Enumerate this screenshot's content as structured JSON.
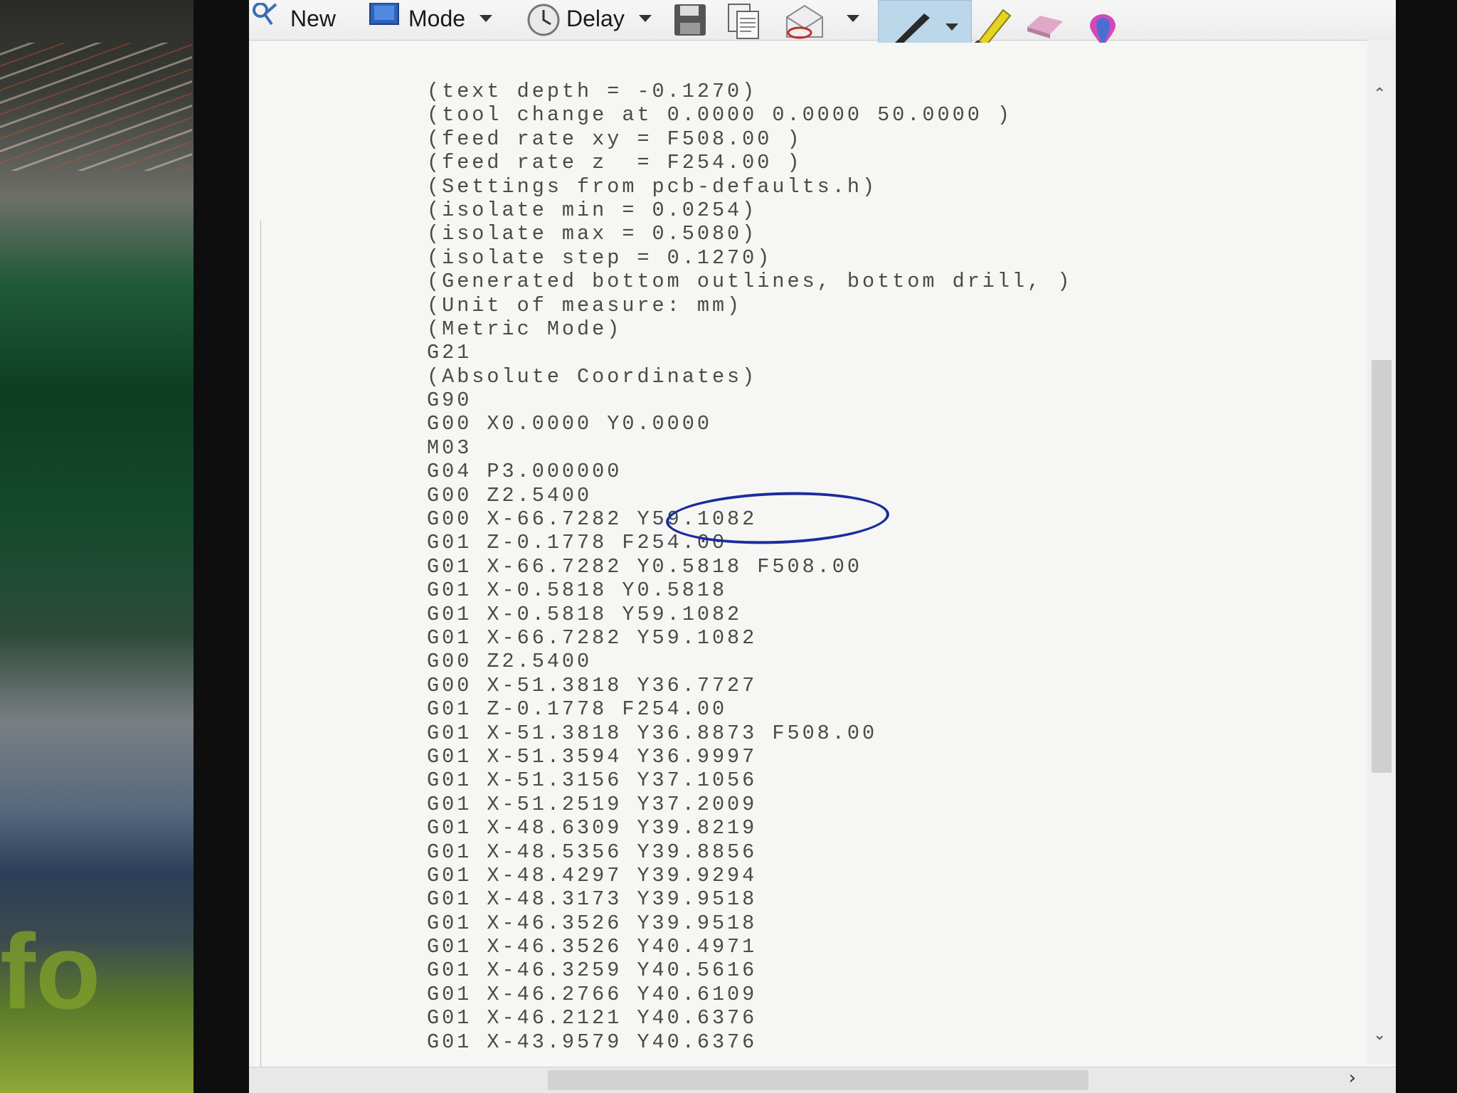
{
  "toolbar": {
    "new_label": "New",
    "mode_label": "Mode",
    "delay_label": "Delay"
  },
  "code_lines": [
    "(text depth = -0.1270)",
    "(tool change at 0.0000 0.0000 50.0000 )",
    "(feed rate xy = F508.00 )",
    "(feed rate z  = F254.00 )",
    "(Settings from pcb-defaults.h)",
    "(isolate min = 0.0254)",
    "(isolate max = 0.5080)",
    "(isolate step = 0.1270)",
    "(Generated bottom outlines, bottom drill, )",
    "(Unit of measure: mm)",
    "(Metric Mode)",
    "G21",
    "(Absolute Coordinates)",
    "G90",
    "G00 X0.0000 Y0.0000",
    "M03",
    "G04 P3.000000",
    "G00 Z2.5400",
    "G00 X-66.7282 Y59.1082",
    "G01 Z-0.1778 F254.00",
    "G01 X-66.7282 Y0.5818 F508.00",
    "G01 X-0.5818 Y0.5818",
    "G01 X-0.5818 Y59.1082",
    "G01 X-66.7282 Y59.1082",
    "G00 Z2.5400",
    "G00 X-51.3818 Y36.7727",
    "G01 Z-0.1778 F254.00",
    "G01 X-51.3818 Y36.8873 F508.00",
    "G01 X-51.3594 Y36.9997",
    "G01 X-51.3156 Y37.1056",
    "G01 X-51.2519 Y37.2009",
    "G01 X-48.6309 Y39.8219",
    "G01 X-48.5356 Y39.8856",
    "G01 X-48.4297 Y39.9294",
    "G01 X-48.3173 Y39.9518",
    "G01 X-46.3526 Y39.9518",
    "G01 X-46.3526 Y40.4971",
    "G01 X-46.3259 Y40.5616",
    "G01 X-46.2766 Y40.6109",
    "G01 X-46.2121 Y40.6376",
    "G01 X-43.9579 Y40.6376"
  ],
  "highlighted_line": "G04 P3.000000",
  "colors": {
    "annotation": "#1b2c9c",
    "pen_group_bg": "#bcd6ea"
  },
  "icons": [
    "new-icon",
    "mode-icon",
    "delay-clock-icon",
    "save-icon",
    "copy-icon",
    "send-email-icon",
    "pen-icon",
    "highlighter-icon",
    "eraser-icon",
    "color-picker-icon"
  ]
}
